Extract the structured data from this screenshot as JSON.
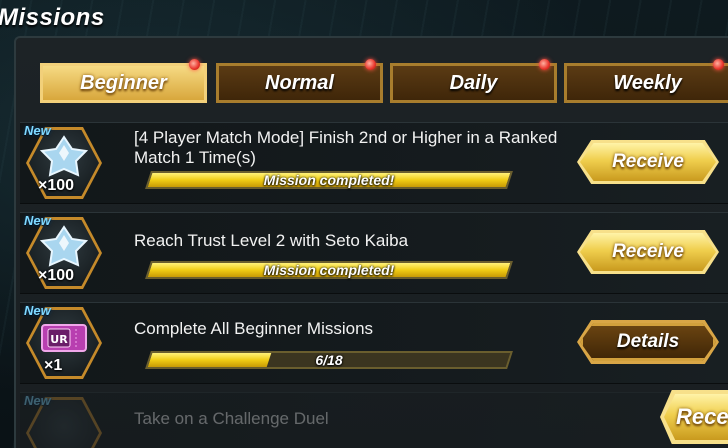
{
  "window": {
    "title": "Missions"
  },
  "tabs": [
    {
      "label": "Beginner",
      "active": true,
      "has_notification": true
    },
    {
      "label": "Normal",
      "active": false,
      "has_notification": true
    },
    {
      "label": "Daily",
      "active": false,
      "has_notification": true
    },
    {
      "label": "Weekly",
      "active": false,
      "has_notification": true
    }
  ],
  "missions": [
    {
      "new_label": "New",
      "reward_icon": "gem-icon",
      "reward_qty": "×100",
      "description": "[4 Player Match Mode] Finish 2nd or Higher in a Ranked Match 1 Time(s)",
      "progress_text": "Mission completed!",
      "progress_fraction": 1.0,
      "button_label": "Receive"
    },
    {
      "new_label": "New",
      "reward_icon": "gem-icon",
      "reward_qty": "×100",
      "description": "Reach Trust Level 2 with Seto Kaiba",
      "progress_text": "Mission completed!",
      "progress_fraction": 1.0,
      "button_label": "Receive"
    },
    {
      "new_label": "New",
      "reward_icon": "ur-ticket-icon",
      "reward_badge": "UR",
      "reward_qty": "×1",
      "description": "Complete All Beginner Missions",
      "progress_text": "6/18",
      "progress_fraction": 0.333,
      "button_label": "Details"
    },
    {
      "new_label": "New",
      "reward_icon": "ticket-icon",
      "description": "Take on a Challenge Duel",
      "button_label": "Receive",
      "partial_button_label": "Rece"
    }
  ],
  "colors": {
    "accent_gold": "#f0cf4e",
    "tab_active": "#f6da83",
    "tab_inactive": "#5b3b14",
    "progress_fill": "#f0cc14",
    "new_tag": "#7fd9ff",
    "notification_dot": "#e8332a"
  }
}
